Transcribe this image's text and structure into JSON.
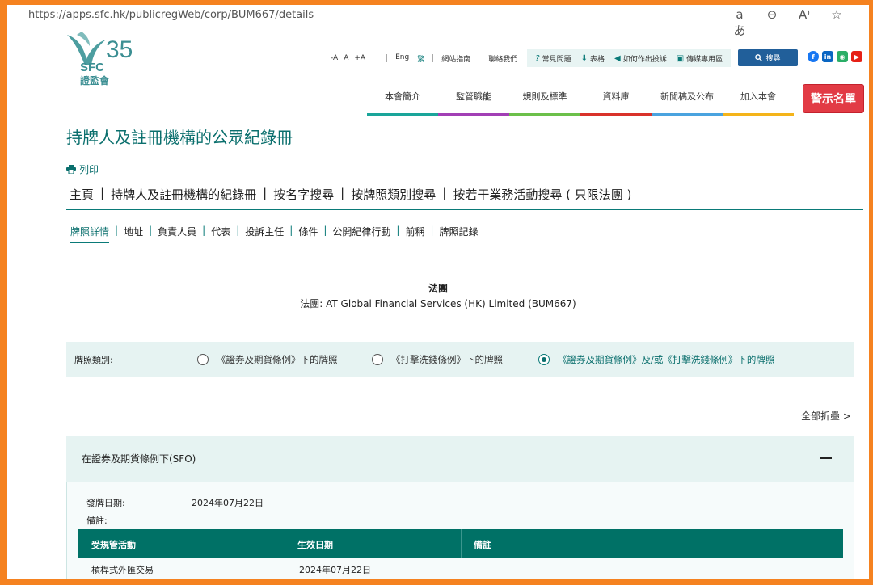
{
  "browser": {
    "url": "https://apps.sfc.hk/publicregWeb/corp/BUM667/details",
    "tools": [
      "aあ",
      "⊖",
      "A⁾",
      "☆"
    ]
  },
  "logo": {
    "abbr": "SFC",
    "anniversary": "35",
    "chinese": "證監會"
  },
  "util": {
    "sizes": [
      "-A",
      "A",
      "+A"
    ],
    "lang_en": "Eng",
    "lang_sc": "繁",
    "links": [
      "網站指南",
      "聯絡我們"
    ],
    "quick": [
      {
        "icon": "question-icon",
        "glyph": "?",
        "label": "常見問題"
      },
      {
        "icon": "download-icon",
        "glyph": "⬇",
        "label": "表格"
      },
      {
        "icon": "megaphone-icon",
        "glyph": "◀",
        "label": "如何作出投訴"
      },
      {
        "icon": "image-icon",
        "glyph": "▣",
        "label": "傳媒專用區"
      }
    ],
    "search_label": "搜尋"
  },
  "social": [
    {
      "name": "facebook-icon",
      "glyph": "f",
      "color": "#1877f2"
    },
    {
      "name": "linkedin-icon",
      "glyph": "in",
      "color": "#0a66c2"
    },
    {
      "name": "wechat-icon",
      "glyph": "◉",
      "color": "#2aae67"
    },
    {
      "name": "youtube-icon",
      "glyph": "▶",
      "color": "#e62117"
    }
  ],
  "nav": [
    {
      "label": "本會簡介",
      "color": "#1aa59a"
    },
    {
      "label": "監管職能",
      "color": "#a23fb5"
    },
    {
      "label": "規則及標準",
      "color": "#6cc04a"
    },
    {
      "label": "資料庫",
      "color": "#d9322a"
    },
    {
      "label": "新聞稿及公布",
      "color": "#4aa3df"
    },
    {
      "label": "加入本會",
      "color": "#f4b41a"
    }
  ],
  "warning_label": "警示名單",
  "page_title": "持牌人及註冊機構的公眾紀錄冊",
  "print_label": "列印",
  "breadcrumb": [
    "主頁",
    "持牌人及註冊機構的紀錄冊",
    "按名字搜尋",
    "按牌照類別搜尋",
    "按若干業務活動搜尋 ( 只限法團 )"
  ],
  "subtabs": [
    "牌照詳情",
    "地址",
    "負責人員",
    "代表",
    "投訴主任",
    "條件",
    "公開紀律行動",
    "前稱",
    "牌照記錄"
  ],
  "entity": {
    "type": "法團",
    "label": "法團: AT Global Financial Services (HK) Limited (BUM667)"
  },
  "licence_type": {
    "label": "牌照類別:",
    "options": [
      "《證券及期貨條例》下的牌照",
      "《打擊洗錢條例》下的牌照",
      "《證券及期貨條例》及/或《打擊洗錢條例》下的牌照"
    ]
  },
  "collapse_all": "全部折疊 >",
  "accordion": {
    "title": "在證券及期貨條例下(SFO)",
    "issue_label": "發牌日期:",
    "issue_date": "2024年07月22日",
    "remarks_label": "備註:",
    "table": {
      "headers": [
        "受規管活動",
        "生效日期",
        "備註"
      ],
      "rows": [
        [
          "槓桿式外匯交易",
          "2024年07月22日",
          ""
        ]
      ]
    }
  }
}
